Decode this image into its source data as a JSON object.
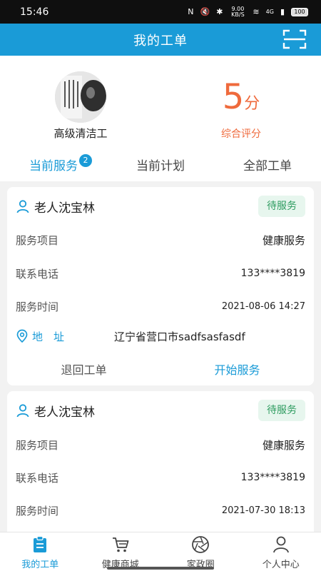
{
  "status_bar": {
    "time": "15:46",
    "net_speed": "9.00 KB/S",
    "signal": "4G",
    "battery": "100"
  },
  "header": {
    "title": "我的工单",
    "scan_icon": "scan-icon"
  },
  "profile": {
    "job_title": "高级清洁工",
    "score_value": "5",
    "score_unit": "分",
    "score_label": "综合评分"
  },
  "tabs": [
    {
      "label": "当前服务",
      "badge": "2",
      "active": true
    },
    {
      "label": "当前计划",
      "active": false
    },
    {
      "label": "全部工单",
      "active": false
    }
  ],
  "orders": [
    {
      "name": "老人沈宝林",
      "status": "待服务",
      "service_label": "服务项目",
      "service_value": "健康服务",
      "phone_label": "联系电话",
      "phone_value": "133****3819",
      "time_label": "服务时间",
      "time_value": "2021-08-06 14:27",
      "address_label": "地　址",
      "address_value": "辽宁省营口市sadfsasfasdf",
      "reject_label": "退回工单",
      "start_label": "开始服务"
    },
    {
      "name": "老人沈宝林",
      "status": "待服务",
      "service_label": "服务项目",
      "service_value": "健康服务",
      "phone_label": "联系电话",
      "phone_value": "133****3819",
      "time_label": "服务时间",
      "time_value": "2021-07-30 18:13"
    }
  ],
  "bottom_nav": [
    {
      "label": "我的工单",
      "icon": "clipboard-icon",
      "active": true
    },
    {
      "label": "健康商城",
      "icon": "cart-icon",
      "active": false
    },
    {
      "label": "家政圈",
      "icon": "aperture-icon",
      "active": false
    },
    {
      "label": "个人中心",
      "icon": "person-icon",
      "active": false
    }
  ],
  "colors": {
    "primary": "#1a9bd7",
    "score": "#ef6a3c",
    "status_tag_bg": "#e7f6ee",
    "status_tag_text": "#2e9c60"
  }
}
